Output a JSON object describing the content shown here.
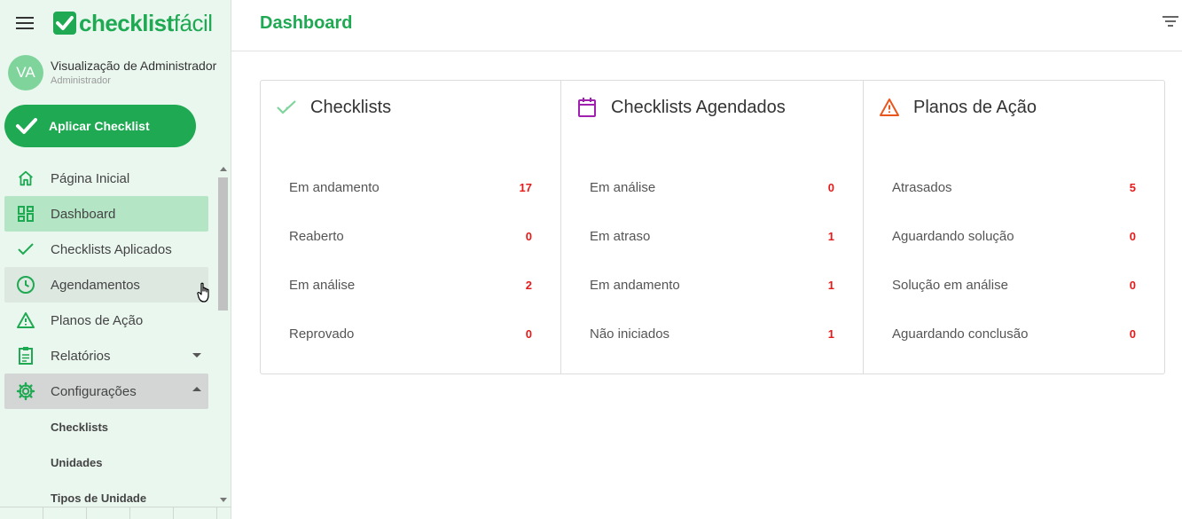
{
  "app": {
    "logo_bold": "checklist",
    "logo_light": "fácil"
  },
  "user": {
    "initials": "VA",
    "name": "Visualização de Administrador",
    "role": "Administrador"
  },
  "apply_button": "Aplicar Checklist",
  "nav": {
    "items": [
      {
        "label": "Página Inicial",
        "icon": "home-icon"
      },
      {
        "label": "Dashboard",
        "icon": "dashboard-icon"
      },
      {
        "label": "Checklists Aplicados",
        "icon": "check-icon"
      },
      {
        "label": "Agendamentos",
        "icon": "clock-icon"
      },
      {
        "label": "Planos de Ação",
        "icon": "warning-icon"
      },
      {
        "label": "Relatórios",
        "icon": "clipboard-icon"
      },
      {
        "label": "Configurações",
        "icon": "gear-icon"
      }
    ],
    "subitems": [
      "Checklists",
      "Unidades",
      "Tipos de Unidade"
    ]
  },
  "header": {
    "title": "Dashboard"
  },
  "cards": [
    {
      "title": "Checklists",
      "icon": "check-icon",
      "rows": [
        {
          "label": "Em andamento",
          "value": "17"
        },
        {
          "label": "Reaberto",
          "value": "0"
        },
        {
          "label": "Em análise",
          "value": "2"
        },
        {
          "label": "Reprovado",
          "value": "0"
        }
      ]
    },
    {
      "title": "Checklists Agendados",
      "icon": "calendar-icon",
      "rows": [
        {
          "label": "Em análise",
          "value": "0"
        },
        {
          "label": "Em atraso",
          "value": "1"
        },
        {
          "label": "Em andamento",
          "value": "1"
        },
        {
          "label": "Não iniciados",
          "value": "1"
        }
      ]
    },
    {
      "title": "Planos de Ação",
      "icon": "warning-icon",
      "rows": [
        {
          "label": "Atrasados",
          "value": "5"
        },
        {
          "label": "Aguardando solução",
          "value": "0"
        },
        {
          "label": "Solução em análise",
          "value": "0"
        },
        {
          "label": "Aguardando conclusão",
          "value": "0"
        }
      ]
    }
  ],
  "colors": {
    "brand": "#1ea952",
    "sidebar_bg": "#eaf7ef",
    "active_bg": "#b4e6c6",
    "count_red": "#e51b1b",
    "calendar_purple": "#a020b0",
    "warning_orange": "#e8561c"
  }
}
